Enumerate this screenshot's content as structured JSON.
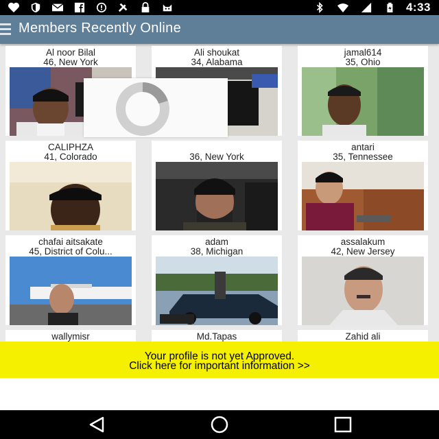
{
  "status_bar": {
    "time": "4:33",
    "left_icons": [
      "heart-icon",
      "shield-icon",
      "mail-icon",
      "facebook-icon",
      "alert-icon",
      "tools-icon",
      "lock-icon",
      "cat-icon"
    ],
    "right_icons": [
      "bluetooth-icon",
      "wifi-icon",
      "signal-icon",
      "battery-icon"
    ]
  },
  "app_bar": {
    "title": "Members Recently Online"
  },
  "members": [
    {
      "name": "Al noor Bilal",
      "info": "46, New York"
    },
    {
      "name": "Ali shoukat",
      "info": "34, Alabama"
    },
    {
      "name": "jamal614",
      "info": "35, Ohio"
    },
    {
      "name": "CALIPHZA",
      "info": "41, Colorado"
    },
    {
      "name": "",
      "info": "36, New York"
    },
    {
      "name": "antari",
      "info": "35, Tennessee"
    },
    {
      "name": "chafai aitsakate",
      "info": "45, District of Colu..."
    },
    {
      "name": "adam",
      "info": "38, Michigan"
    },
    {
      "name": "assalakum",
      "info": "42, New Jersey"
    },
    {
      "name": "wallymisr",
      "info": ""
    },
    {
      "name": "Md.Tapas",
      "info": ""
    },
    {
      "name": "Zahid ali",
      "info": ""
    }
  ],
  "banner": {
    "line1": "Your profile is not yet Approved.",
    "line2": "Click here for important information >>"
  },
  "colors": {
    "app_bar": "#5f7f98",
    "banner": "#f4f000",
    "page_bg": "#e9e9e9"
  }
}
